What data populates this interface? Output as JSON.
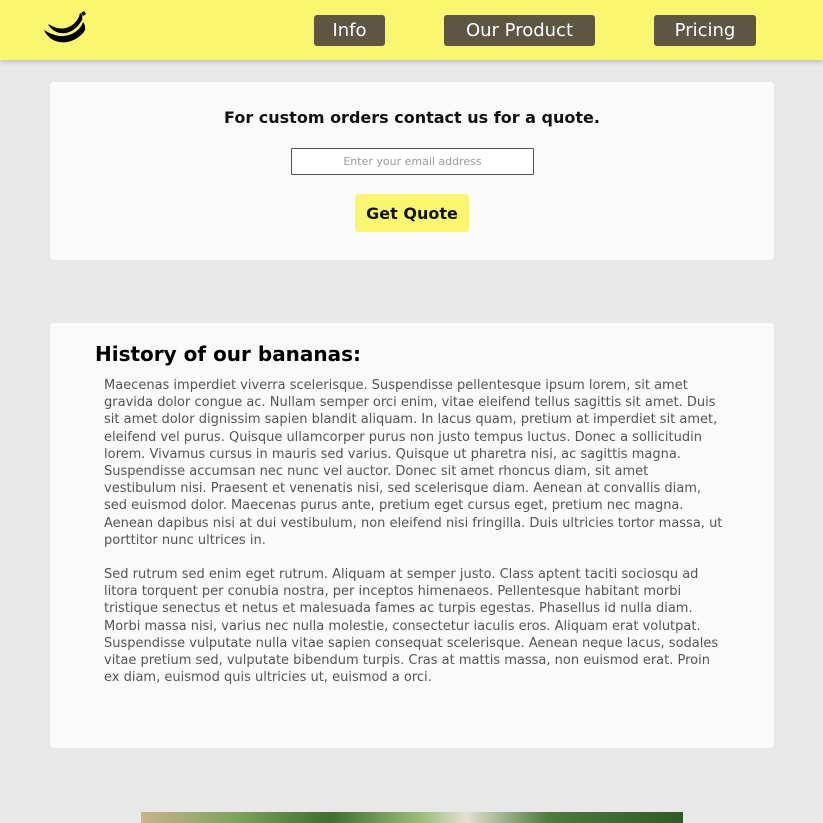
{
  "nav": {
    "logo_icon": "banana-logo-icon",
    "items": [
      {
        "label": "Info"
      },
      {
        "label": "Our Product"
      },
      {
        "label": "Pricing"
      }
    ]
  },
  "quote": {
    "title": "For custom orders contact us for a quote.",
    "email_placeholder": "Enter your email address",
    "email_value": "",
    "button_label": "Get Quote"
  },
  "history": {
    "title": "History of our bananas:",
    "paragraphs": [
      "Maecenas imperdiet viverra scelerisque. Suspendisse pellentesque ipsum lorem, sit amet gravida dolor congue ac. Nullam semper orci enim, vitae eleifend tellus sagittis sit amet. Duis sit amet dolor dignissim sapien blandit aliquam. In lacus quam, pretium at imperdiet sit amet, eleifend vel purus. Quisque ullamcorper purus non justo tempus luctus. Donec a sollicitudin lorem. Vivamus cursus in mauris sed varius. Quisque ut pharetra nisi, ac sagittis magna. Suspendisse accumsan nec nunc vel auctor. Donec sit amet rhoncus diam, sit amet vestibulum nisi. Praesent et venenatis nisi, sed scelerisque diam. Aenean at convallis diam, sed euismod dolor. Maecenas purus ante, pretium eget cursus eget, pretium nec magna. Aenean dapibus nisi at dui vestibulum, non eleifend nisi fringilla. Duis ultricies tortor massa, ut porttitor nunc ultrices in.",
      "Sed rutrum sed enim eget rutrum. Aliquam at semper justo. Class aptent taciti sociosqu ad litora torquent per conubia nostra, per inceptos himenaeos. Pellentesque habitant morbi tristique senectus et netus et malesuada fames ac turpis egestas. Phasellus id nulla diam. Morbi massa nisi, varius nec nulla molestie, consectetur iaculis eros. Aliquam erat volutpat. Suspendisse vulputate nulla vitae sapien consequat scelerisque. Aenean neque lacus, sodales vitae pretium sed, vulputate bibendum turpis. Cras at mattis massa, non euismod erat. Proin ex diam, euismod quis ultricies ut, euismod a orci."
    ]
  },
  "colors": {
    "header_bg": "#faf76f",
    "nav_button_bg": "#5e5642",
    "page_bg": "#e8e8e8",
    "card_bg": "#fafafa"
  }
}
